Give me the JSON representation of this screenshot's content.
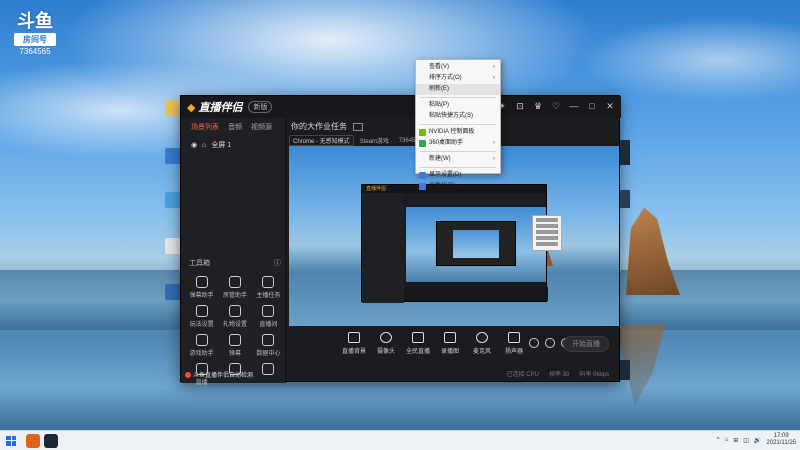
{
  "douyu": {
    "brand": "斗鱼",
    "box_label": "房间号",
    "room_number": "7364565"
  },
  "app": {
    "logo_text": "直播伴侣",
    "version": "新版",
    "title_controls": [
      "✦",
      "⊡",
      "♛",
      "♡",
      "—",
      "□",
      "✕"
    ]
  },
  "left_panel": {
    "tabs": [
      "场景列表",
      "音频",
      "视频源"
    ],
    "scene_name": "全屏 1",
    "tools_title": "工具箱",
    "tools": [
      {
        "label": "弹幕助手"
      },
      {
        "label": "房管助手"
      },
      {
        "label": "主播任务"
      },
      {
        "label": "玩法设置"
      },
      {
        "label": "礼物设置"
      },
      {
        "label": "直播间"
      },
      {
        "label": "游戏助手"
      },
      {
        "label": "弹幕"
      },
      {
        "label": "数据中心"
      },
      {
        "label": "直播"
      },
      {
        "label": ""
      },
      {
        "label": ""
      }
    ],
    "notice": "斗鱼直播伴侣自动检测",
    "accent_color": "#ff5b3c"
  },
  "stream_info": {
    "title": "你的大作业任务",
    "meta": [
      "Chrome - 无感知模式",
      "Steam游戏 ·",
      "7364565"
    ]
  },
  "context_menu": {
    "items": [
      {
        "label": "查看(V)",
        "submenu": true
      },
      {
        "label": "排序方式(O)",
        "submenu": true
      },
      {
        "label": "刷新(E)",
        "highlight": true
      },
      {
        "sep": true
      },
      {
        "label": "粘贴(P)"
      },
      {
        "label": "粘贴快捷方式(S)"
      },
      {
        "sep": true
      },
      {
        "label": "NVIDIA 控制面板",
        "icon_color": "#76b900"
      },
      {
        "label": "360桌面助手",
        "icon_color": "#2fa84f",
        "submenu": true
      },
      {
        "sep": true
      },
      {
        "label": "新建(W)",
        "submenu": true
      },
      {
        "sep": true
      },
      {
        "label": "显示设置(D)",
        "icon_color": "#3b7dd8"
      },
      {
        "label": "个性化(R)",
        "icon_color": "#3b7dd8"
      }
    ]
  },
  "controls": [
    {
      "label": "直播背景"
    },
    {
      "label": "摄像头"
    },
    {
      "label": "全民直播"
    },
    {
      "label": "录播图"
    },
    {
      "label": "麦克风"
    },
    {
      "label": "扬声器"
    }
  ],
  "start_button": "开始直播",
  "status_bar": [
    "已连接 CPU",
    "帧率 30",
    "码率 0kbps"
  ],
  "taskbar": {
    "time": "17:09",
    "date": "2021/11/25",
    "tray_icons": [
      "^",
      "⌂",
      "⊞",
      "◫",
      "🔊"
    ],
    "app_colors": [
      "#e0631b",
      "#1b2838"
    ]
  }
}
